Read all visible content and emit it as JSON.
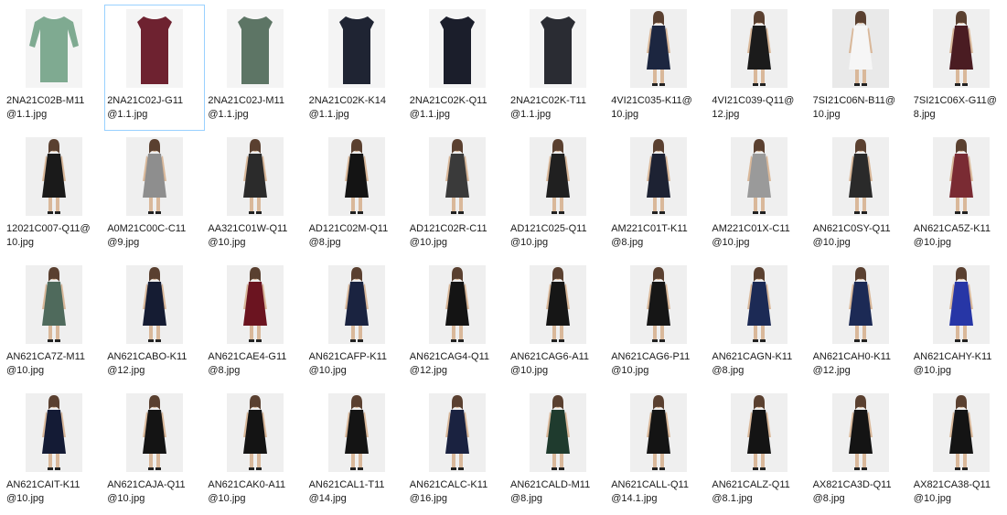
{
  "files": [
    {
      "name": "2NA21C02B-M11\n@1.1.jpg",
      "color": "#7faa91",
      "style": "sleeve",
      "bg": "#f4f4f4"
    },
    {
      "name": "2NA21C02J-G11\n@1.1.jpg",
      "color": "#6e2230",
      "style": "sheath",
      "bg": "#f4f4f4",
      "selected": true
    },
    {
      "name": "2NA21C02J-M11\n@1.1.jpg",
      "color": "#5d7565",
      "style": "sheath",
      "bg": "#f4f4f4"
    },
    {
      "name": "2NA21C02K-K14\n@1.1.jpg",
      "color": "#1f2433",
      "style": "sheath",
      "bg": "#f4f4f4"
    },
    {
      "name": "2NA21C02K-Q11\n@1.1.jpg",
      "color": "#1b1e2b",
      "style": "sheath",
      "bg": "#f4f4f4"
    },
    {
      "name": "2NA21C02K-T11\n@1.1.jpg",
      "color": "#2a2c33",
      "style": "sheath",
      "bg": "#f4f4f4"
    },
    {
      "name": "4VI21C035-K11@\n10.jpg",
      "color": "#1c2640",
      "style": "model",
      "bg": "#efefef"
    },
    {
      "name": "4VI21C039-Q11@\n12.jpg",
      "color": "#1b1b1b",
      "style": "model",
      "bg": "#efefef"
    },
    {
      "name": "7SI21C06N-B11@\n10.jpg",
      "color": "#f6f6f6",
      "style": "model",
      "bg": "#e9e9e9"
    },
    {
      "name": "7SI21C06X-G11@\n8.jpg",
      "color": "#4a1c22",
      "style": "model",
      "bg": "#efefef"
    },
    {
      "name": "12021C007-Q11@\n10.jpg",
      "color": "#1a1a1a",
      "style": "model",
      "bg": "#efefef"
    },
    {
      "name": "A0M21C00C-C11\n@9.jpg",
      "color": "#8e8e8e",
      "style": "model",
      "bg": "#efefef"
    },
    {
      "name": "AA321C01W-Q11\n@10.jpg",
      "color": "#2b2b2b",
      "style": "model",
      "bg": "#efefef"
    },
    {
      "name": "AD121C02M-Q11\n@8.jpg",
      "color": "#141414",
      "style": "model",
      "bg": "#efefef"
    },
    {
      "name": "AD121C02R-C11\n@10.jpg",
      "color": "#3a3a3a",
      "style": "model",
      "bg": "#efefef"
    },
    {
      "name": "AD121C025-Q11\n@10.jpg",
      "color": "#202020",
      "style": "model",
      "bg": "#efefef"
    },
    {
      "name": "AM221C01T-K11\n@8.jpg",
      "color": "#1d2233",
      "style": "model",
      "bg": "#efefef"
    },
    {
      "name": "AM221C01X-C11\n@10.jpg",
      "color": "#9a9a9a",
      "style": "model",
      "bg": "#efefef"
    },
    {
      "name": "AN621C0SY-Q11\n@10.jpg",
      "color": "#2a2a2a",
      "style": "model",
      "bg": "#efefef"
    },
    {
      "name": "AN621CA5Z-K11\n@10.jpg",
      "color": "#7a2b33",
      "style": "model",
      "bg": "#efefef"
    },
    {
      "name": "AN621CA7Z-M11\n@10.jpg",
      "color": "#4f6a5c",
      "style": "model",
      "bg": "#efefef"
    },
    {
      "name": "AN621CABO-K11\n@12.jpg",
      "color": "#151c33",
      "style": "model",
      "bg": "#efefef"
    },
    {
      "name": "AN621CAE4-G11\n@8.jpg",
      "color": "#6b1420",
      "style": "model",
      "bg": "#efefef"
    },
    {
      "name": "AN621CAFP-K11\n@10.jpg",
      "color": "#1a2340",
      "style": "model",
      "bg": "#efefef"
    },
    {
      "name": "AN621CAG4-Q11\n@12.jpg",
      "color": "#141414",
      "style": "model",
      "bg": "#efefef"
    },
    {
      "name": "AN621CAG6-A11\n@10.jpg",
      "color": "#161616",
      "style": "model",
      "bg": "#efefef"
    },
    {
      "name": "AN621CAG6-P11\n@10.jpg",
      "color": "#161616",
      "style": "model",
      "bg": "#efefef"
    },
    {
      "name": "AN621CAGN-K11\n@8.jpg",
      "color": "#1c2a55",
      "style": "model",
      "bg": "#efefef"
    },
    {
      "name": "AN621CAH0-K11\n@12.jpg",
      "color": "#1c2a55",
      "style": "model",
      "bg": "#efefef"
    },
    {
      "name": "AN621CAHY-K11\n@10.jpg",
      "color": "#2736a6",
      "style": "model",
      "bg": "#efefef"
    },
    {
      "name": "AN621CAIT-K11\n@10.jpg",
      "color": "#141b35",
      "style": "model",
      "bg": "#efefef"
    },
    {
      "name": "AN621CAJA-Q11\n@10.jpg",
      "color": "#141414",
      "style": "model",
      "bg": "#efefef"
    },
    {
      "name": "AN621CAK0-A11\n@10.jpg",
      "color": "#141414",
      "style": "model",
      "bg": "#efefef"
    },
    {
      "name": "AN621CAL1-T11\n@14.jpg",
      "color": "#141414",
      "style": "model",
      "bg": "#efefef"
    },
    {
      "name": "AN621CALC-K11\n@16.jpg",
      "color": "#1a2240",
      "style": "model",
      "bg": "#efefef"
    },
    {
      "name": "AN621CALD-M11\n@8.jpg",
      "color": "#1f3b2e",
      "style": "model",
      "bg": "#efefef"
    },
    {
      "name": "AN621CALL-Q11\n@14.1.jpg",
      "color": "#141414",
      "style": "model",
      "bg": "#efefef"
    },
    {
      "name": "AN621CALZ-Q11\n@8.1.jpg",
      "color": "#141414",
      "style": "model",
      "bg": "#efefef"
    },
    {
      "name": "AX821CA3D-Q11\n@8.jpg",
      "color": "#141414",
      "style": "model",
      "bg": "#efefef"
    },
    {
      "name": "AX821CA38-Q11\n@10.jpg",
      "color": "#141414",
      "style": "model",
      "bg": "#efefef"
    }
  ]
}
